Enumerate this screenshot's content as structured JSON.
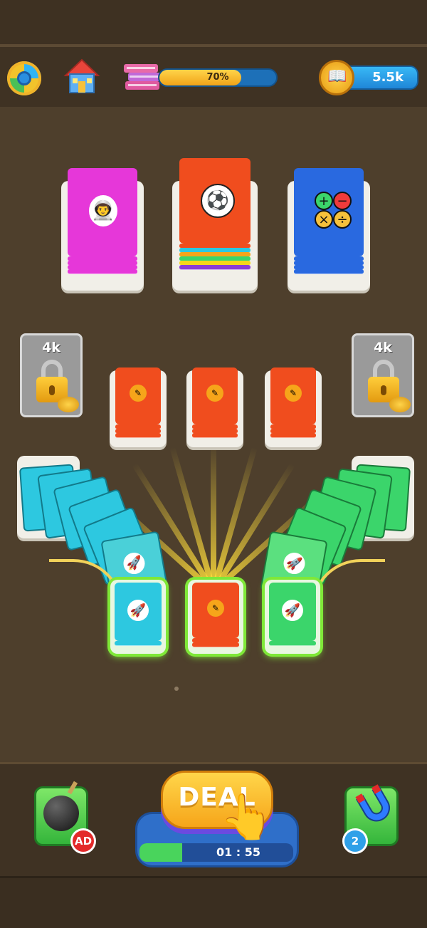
{
  "header": {
    "progress_percent": 70,
    "progress_label": "70%",
    "coins": "5.5k"
  },
  "board": {
    "top_stacks": [
      {
        "name": "astronaut-book",
        "color": "#e637d9",
        "icon": "astronaut-icon"
      },
      {
        "name": "soccer-book",
        "color": "#f04d1e",
        "icon": "soccer-ball-icon"
      },
      {
        "name": "math-book",
        "color": "#2969e0",
        "icon": "math-operators-icon"
      }
    ],
    "locked_slots": [
      {
        "price": "4k"
      },
      {
        "price": "4k"
      }
    ],
    "middle_stacks": [
      {
        "color": "#f04d1e",
        "icon": "pencil-coin-icon"
      },
      {
        "color": "#f04d1e",
        "icon": "pencil-coin-icon"
      },
      {
        "color": "#f04d1e",
        "icon": "pencil-coin-icon"
      }
    ],
    "bottom_stacks": [
      {
        "color": "#2dc8e0",
        "icon": "rocket-icon"
      },
      {
        "color": "#f04d1e",
        "icon": "pencil-coin-icon"
      },
      {
        "color": "#3bd56b",
        "icon": "rocket-icon"
      }
    ]
  },
  "footer": {
    "bomb_badge": "AD",
    "deal_label": "DEAL",
    "timer": "01 : 55",
    "magnet_count": "2"
  }
}
